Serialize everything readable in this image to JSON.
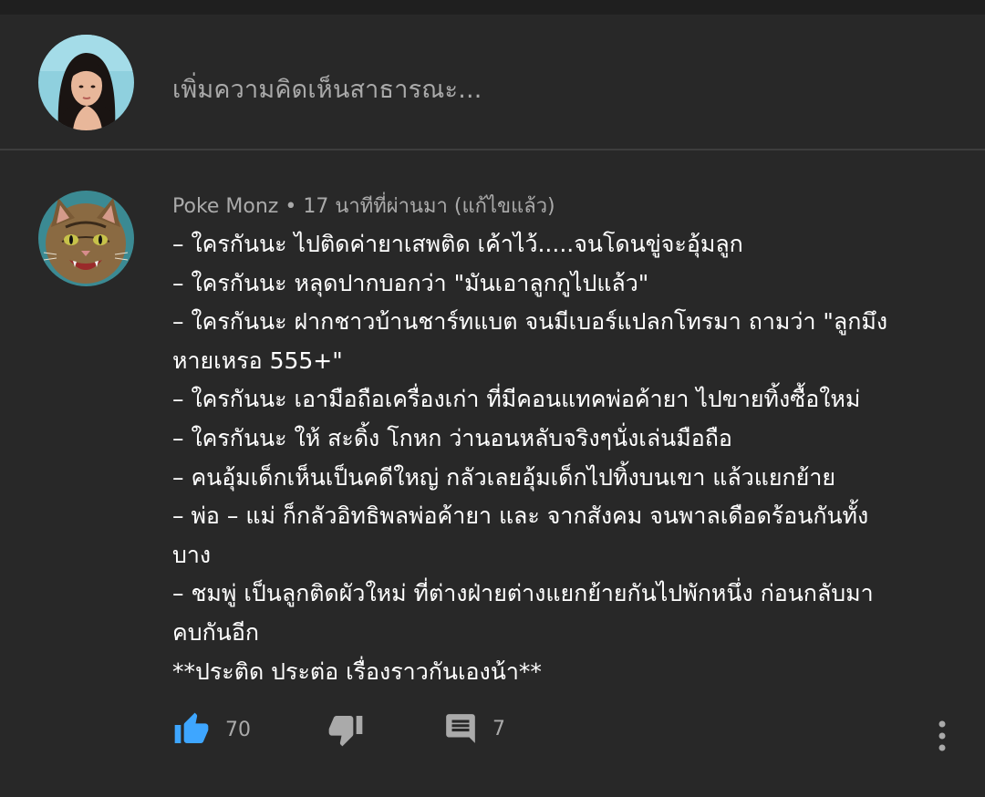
{
  "composer": {
    "placeholder": "เพิ่มความคิดเห็นสาธารณะ..."
  },
  "comment": {
    "author": "Poke Monz",
    "separator": "•",
    "timestamp": "17 นาทีที่ผ่านมา (แก้ไขแล้ว)",
    "lines": [
      "– ใครกันนะ ไปติดค่ายาเสพติด เค้าไว้.....จนโดนขู่จะอุ้มลูก",
      "– ใครกันนะ หลุดปากบอกว่า \"มันเอาลูกกูไปแล้ว\"",
      "– ใครกันนะ ฝากชาวบ้านชาร์ทแบต จนมีเบอร์แปลกโทรมา ถามว่า \"ลูกมึง",
      "หายเหรอ 555+\"",
      "– ใครกันนะ เอามือถือเครื่องเก่า ที่มีคอนแทคพ่อค้ายา ไปขายทิ้งซื้อใหม่",
      "– ใครกันนะ ให้ สะดิ้ง โกหก ว่านอนหลับจริงๆนั่งเล่นมือถือ",
      "– คนอุ้มเด็กเห็นเป็นคดีใหญ่ กลัวเลยอุ้มเด็กไปทิ้งบนเขา แล้วแยกย้าย",
      "– พ่อ – แม่ ก็กลัวอิทธิพลพ่อค้ายา และ จากสังคม จนพาลเดือดร้อนกันทั้ง",
      "บาง",
      "– ชมพู่ เป็นลูกติดผัวใหม่ ที่ต่างฝ่ายต่างแยกย้ายกันไปพักหนึ่ง ก่อนกลับมา",
      "คบกันอีก",
      "**ประติด ประต่อ เรื่องราวกันเองน้า**"
    ],
    "likes": "70",
    "replies": "7"
  },
  "colors": {
    "background": "#282828",
    "like_blue": "#3ea6ff",
    "icon_gray": "#aaaaaa"
  },
  "icons": {
    "like": "thumbs-up-icon",
    "dislike": "thumbs-down-icon",
    "reply": "reply-comment-icon",
    "more": "more-vertical-icon"
  }
}
